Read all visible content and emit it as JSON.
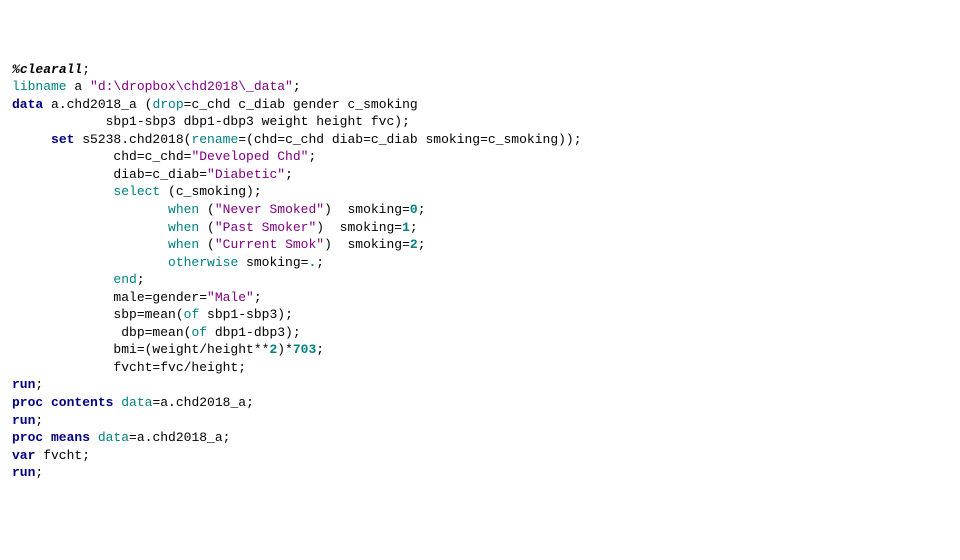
{
  "lines": [
    [
      [
        "macro",
        "%"
      ],
      [
        "macro",
        "clearall"
      ],
      [
        "plain",
        ";"
      ]
    ],
    [
      [
        "opt",
        "libname"
      ],
      [
        "plain",
        " a "
      ],
      [
        "str",
        "\"d:\\dropbox\\chd2018\\_data\""
      ],
      [
        "plain",
        ";"
      ]
    ],
    [
      [
        "kw",
        "data"
      ],
      [
        "plain",
        " a.chd2018_a ("
      ],
      [
        "opt",
        "drop"
      ],
      [
        "plain",
        "=c_chd c_diab gender c_smoking"
      ]
    ],
    [
      [
        "plain",
        "            sbp1-sbp3 dbp1-dbp3 weight height fvc);"
      ]
    ],
    [
      [
        "plain",
        "     "
      ],
      [
        "kw",
        "set"
      ],
      [
        "plain",
        " s5238.chd2018("
      ],
      [
        "opt",
        "rename"
      ],
      [
        "plain",
        "=(chd=c_chd diab=c_diab smoking=c_smoking));"
      ]
    ],
    [
      [
        "plain",
        "             chd=c_chd="
      ],
      [
        "str",
        "\"Developed Chd\""
      ],
      [
        "plain",
        ";"
      ]
    ],
    [
      [
        "plain",
        "             diab=c_diab="
      ],
      [
        "str",
        "\"Diabetic\""
      ],
      [
        "plain",
        ";"
      ]
    ],
    [
      [
        "plain",
        "             "
      ],
      [
        "opt",
        "select"
      ],
      [
        "plain",
        " (c_smoking);"
      ]
    ],
    [
      [
        "plain",
        "                    "
      ],
      [
        "opt",
        "when"
      ],
      [
        "plain",
        " ("
      ],
      [
        "str",
        "\"Never Smoked\""
      ],
      [
        "plain",
        ")  smoking="
      ],
      [
        "num",
        "0"
      ],
      [
        "plain",
        ";"
      ]
    ],
    [
      [
        "plain",
        "                    "
      ],
      [
        "opt",
        "when"
      ],
      [
        "plain",
        " ("
      ],
      [
        "str",
        "\"Past Smoker\""
      ],
      [
        "plain",
        ")  smoking="
      ],
      [
        "num",
        "1"
      ],
      [
        "plain",
        ";"
      ]
    ],
    [
      [
        "plain",
        "                    "
      ],
      [
        "opt",
        "when"
      ],
      [
        "plain",
        " ("
      ],
      [
        "str",
        "\"Current Smok\""
      ],
      [
        "plain",
        ")  smoking="
      ],
      [
        "num",
        "2"
      ],
      [
        "plain",
        ";"
      ]
    ],
    [
      [
        "plain",
        "                    "
      ],
      [
        "opt",
        "otherwise"
      ],
      [
        "plain",
        " smoking="
      ],
      [
        "num",
        "."
      ],
      [
        "plain",
        ";"
      ]
    ],
    [
      [
        "plain",
        "             "
      ],
      [
        "opt",
        "end"
      ],
      [
        "plain",
        ";"
      ]
    ],
    [
      [
        "plain",
        "             male=gender="
      ],
      [
        "str",
        "\"Male\""
      ],
      [
        "plain",
        ";"
      ]
    ],
    [
      [
        "plain",
        "             sbp=mean("
      ],
      [
        "opt",
        "of"
      ],
      [
        "plain",
        " sbp1-sbp3);"
      ]
    ],
    [
      [
        "plain",
        "              dbp=mean("
      ],
      [
        "opt",
        "of"
      ],
      [
        "plain",
        " dbp1-dbp3);"
      ]
    ],
    [
      [
        "plain",
        "             bmi=(weight/height**"
      ],
      [
        "num",
        "2"
      ],
      [
        "plain",
        ")*"
      ],
      [
        "num",
        "703"
      ],
      [
        "plain",
        ";"
      ]
    ],
    [
      [
        "plain",
        "             fvcht=fvc/height;"
      ]
    ],
    [
      [
        "kw",
        "run"
      ],
      [
        "plain",
        ";"
      ]
    ],
    [
      [
        "kw",
        "proc contents"
      ],
      [
        "plain",
        " "
      ],
      [
        "opt",
        "data"
      ],
      [
        "plain",
        "=a.chd2018_a;"
      ]
    ],
    [
      [
        "kw",
        "run"
      ],
      [
        "plain",
        ";"
      ]
    ],
    [
      [
        "kw",
        "proc means"
      ],
      [
        "plain",
        " "
      ],
      [
        "opt",
        "data"
      ],
      [
        "plain",
        "=a.chd2018_a;"
      ]
    ],
    [
      [
        "kw",
        "var"
      ],
      [
        "plain",
        " fvcht;"
      ]
    ],
    [
      [
        "kw",
        "run"
      ],
      [
        "plain",
        ";"
      ]
    ]
  ]
}
